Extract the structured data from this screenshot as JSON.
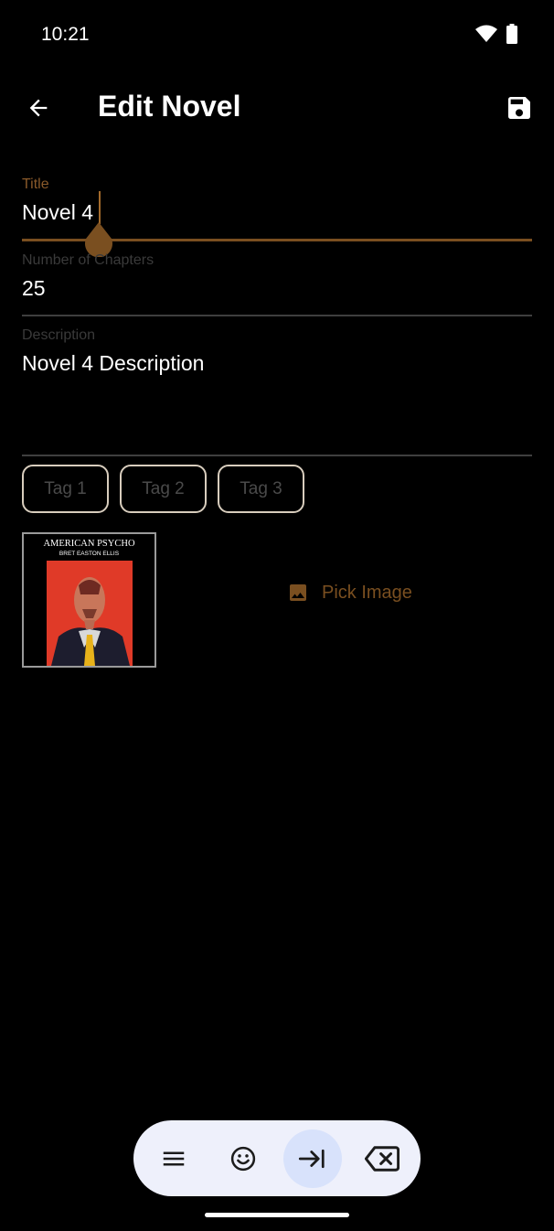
{
  "status_bar": {
    "time": "10:21",
    "icons": [
      "wifi-icon",
      "battery-icon"
    ]
  },
  "app_bar": {
    "title": "Edit Novel",
    "back_icon": "arrow-back-icon",
    "save_icon": "save-icon"
  },
  "form": {
    "title": {
      "label": "Title",
      "value": "Novel 4"
    },
    "chapters": {
      "label": "Number of Chapters",
      "value": "25"
    },
    "description": {
      "label": "Description",
      "value": "Novel 4 Description"
    }
  },
  "tags": [
    "Tag 1",
    "Tag 2",
    "Tag 3"
  ],
  "cover": {
    "title": "AMERICAN PSYCHO",
    "author": "BRET EASTON ELLIS"
  },
  "pick_image": {
    "label": "Pick Image",
    "icon": "image-icon"
  },
  "keyboard_toolbar": {
    "items": [
      "menu-icon",
      "emoji-icon",
      "tab-icon",
      "backspace-icon"
    ]
  },
  "colors": {
    "accent": "#7a4f20",
    "background": "#000000",
    "toolbar_bg": "#eef0fb",
    "toolbar_selected": "#d8e2fb"
  }
}
